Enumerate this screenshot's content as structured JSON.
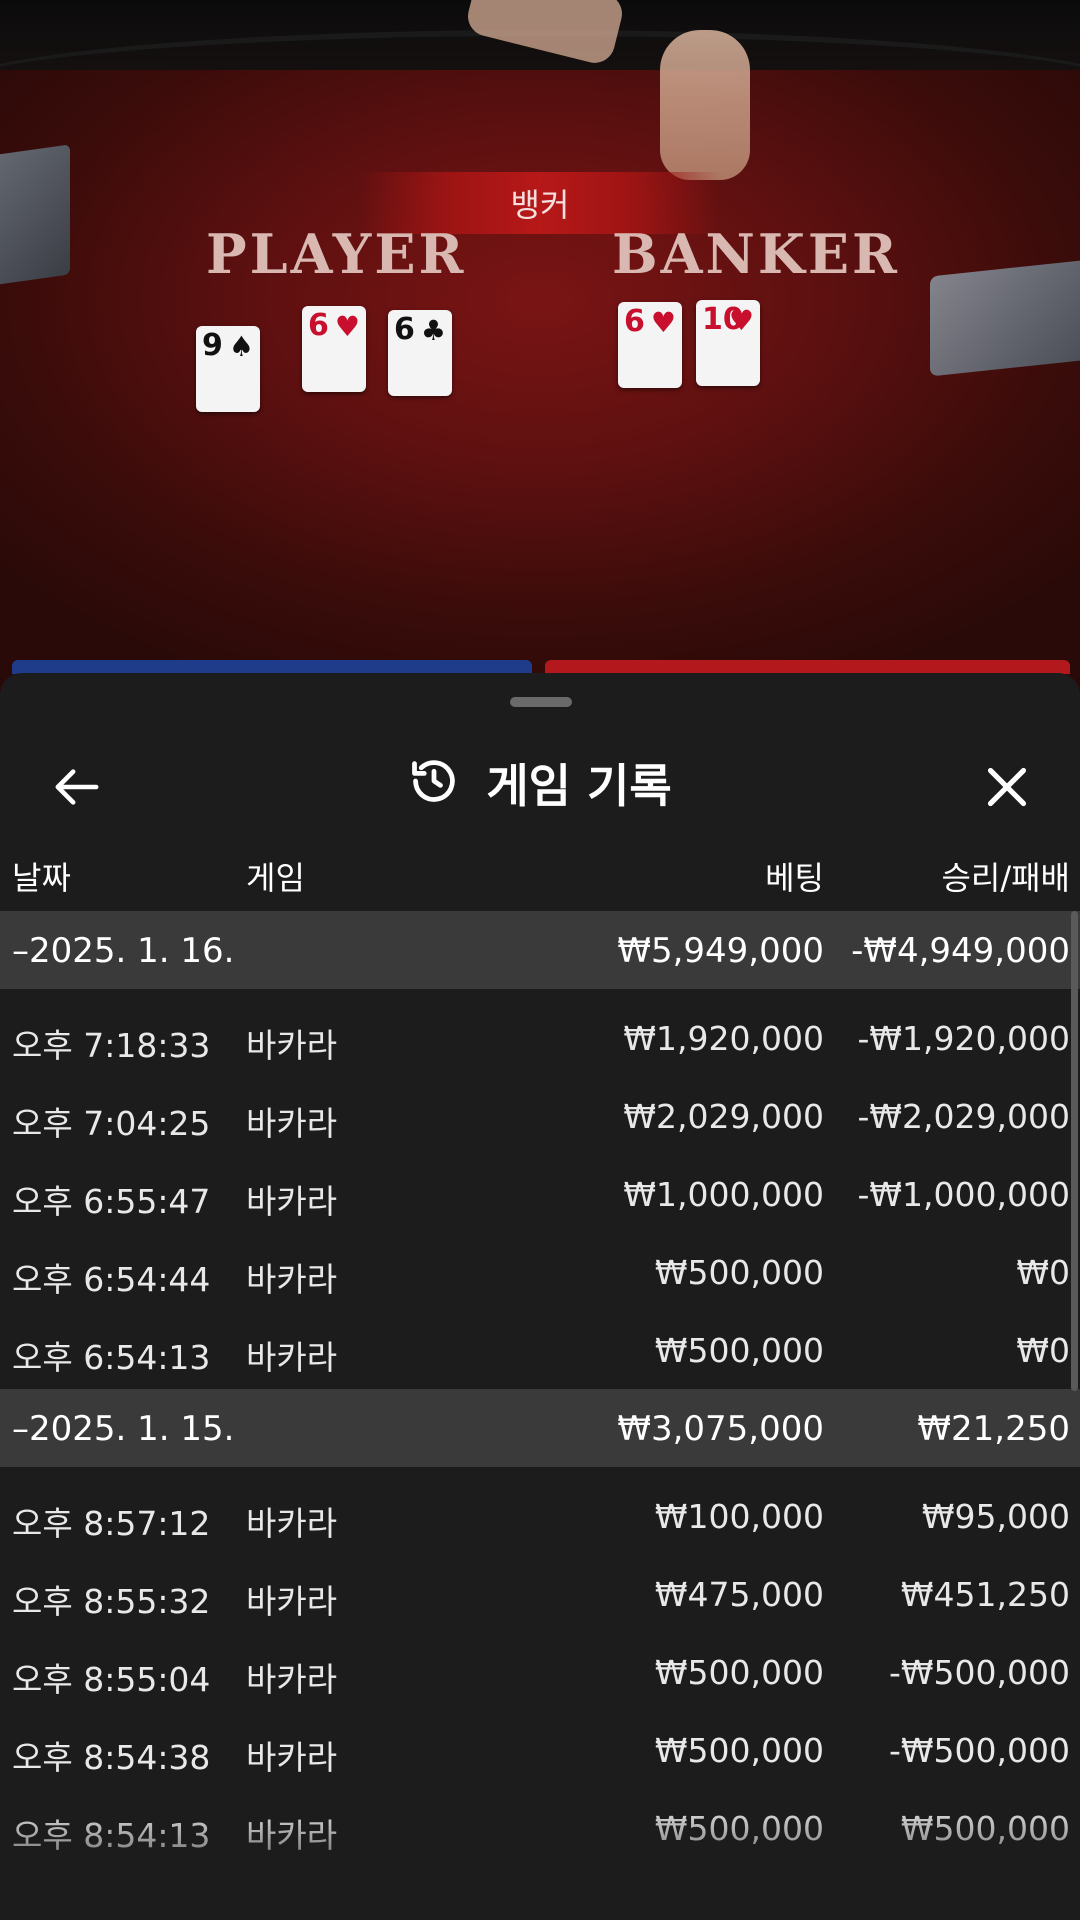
{
  "table": {
    "result_banner": "뱅커",
    "player_label": "PLAYER",
    "banker_label": "BANKER",
    "player_cards": [
      {
        "rank": "9",
        "suit": "♠",
        "color": "black"
      },
      {
        "rank": "6",
        "suit": "♥",
        "color": "red"
      },
      {
        "rank": "6",
        "suit": "♣",
        "color": "black"
      }
    ],
    "banker_cards": [
      {
        "rank": "6",
        "suit": "♥",
        "color": "red"
      },
      {
        "rank": "10",
        "suit": "♥",
        "color": "red"
      }
    ]
  },
  "sheet": {
    "back_icon": "arrow-left-icon",
    "history_icon": "history-icon",
    "close_icon": "close-icon",
    "title": "게임 기록",
    "columns": {
      "date": "날짜",
      "game": "게임",
      "bet": "베팅",
      "win_loss": "승리/패배"
    },
    "groups": [
      {
        "date": "–2025. 1. 16.",
        "bet_total": "₩5,949,000",
        "win_total": "-₩4,949,000",
        "rows": [
          {
            "time": "오후 7:18:33",
            "game": "바카라",
            "bet": "₩1,920,000",
            "result": "-₩1,920,000"
          },
          {
            "time": "오후 7:04:25",
            "game": "바카라",
            "bet": "₩2,029,000",
            "result": "-₩2,029,000"
          },
          {
            "time": "오후 6:55:47",
            "game": "바카라",
            "bet": "₩1,000,000",
            "result": "-₩1,000,000"
          },
          {
            "time": "오후 6:54:44",
            "game": "바카라",
            "bet": "₩500,000",
            "result": "₩0"
          },
          {
            "time": "오후 6:54:13",
            "game": "바카라",
            "bet": "₩500,000",
            "result": "₩0"
          }
        ]
      },
      {
        "date": "–2025. 1. 15.",
        "bet_total": "₩3,075,000",
        "win_total": "₩21,250",
        "rows": [
          {
            "time": "오후 8:57:12",
            "game": "바카라",
            "bet": "₩100,000",
            "result": "₩95,000"
          },
          {
            "time": "오후 8:55:32",
            "game": "바카라",
            "bet": "₩475,000",
            "result": "₩451,250"
          },
          {
            "time": "오후 8:55:04",
            "game": "바카라",
            "bet": "₩500,000",
            "result": "-₩500,000"
          },
          {
            "time": "오후 8:54:38",
            "game": "바카라",
            "bet": "₩500,000",
            "result": "-₩500,000"
          },
          {
            "time": "오후 8:54:13",
            "game": "바카라",
            "bet": "₩500,000",
            "result": "₩500,000"
          }
        ]
      }
    ]
  }
}
